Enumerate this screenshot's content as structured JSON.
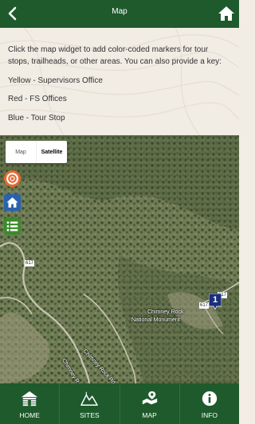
{
  "header": {
    "title": "Map"
  },
  "intro": {
    "paragraphs": [
      "Click the map widget to add color-coded markers for tour stops, trailheads, or other areas. You can also provide a key:",
      "Yellow - Supervisors Office",
      "Red - FS Offices",
      "Blue - Tour Stop"
    ]
  },
  "map": {
    "map_type": {
      "map_label": "Map",
      "satellite_label": "Satellite",
      "selected": "Satellite"
    },
    "labels": {
      "place_line1": "Chimney Rock",
      "place_line2": "National Monument",
      "road_name": "Chimney Rock Rd",
      "road_name_partial": "Chimney R",
      "route_617_a": "617",
      "route_617_b": "617",
      "route_617_c": "617"
    },
    "marker": {
      "number": "1",
      "color": "#1b2f7a"
    },
    "side_buttons": [
      "lifesaver-icon",
      "home-icon",
      "list-icon"
    ]
  },
  "nav": {
    "tabs": [
      {
        "label": "HOME",
        "icon": "cabin-icon"
      },
      {
        "label": "SITES",
        "icon": "mountains-icon"
      },
      {
        "label": "MAP",
        "icon": "map-pin-icon"
      },
      {
        "label": "INFO",
        "icon": "info-icon"
      }
    ]
  },
  "colors": {
    "brand_green": "#1e5a2c",
    "background": "#f1ece4"
  }
}
